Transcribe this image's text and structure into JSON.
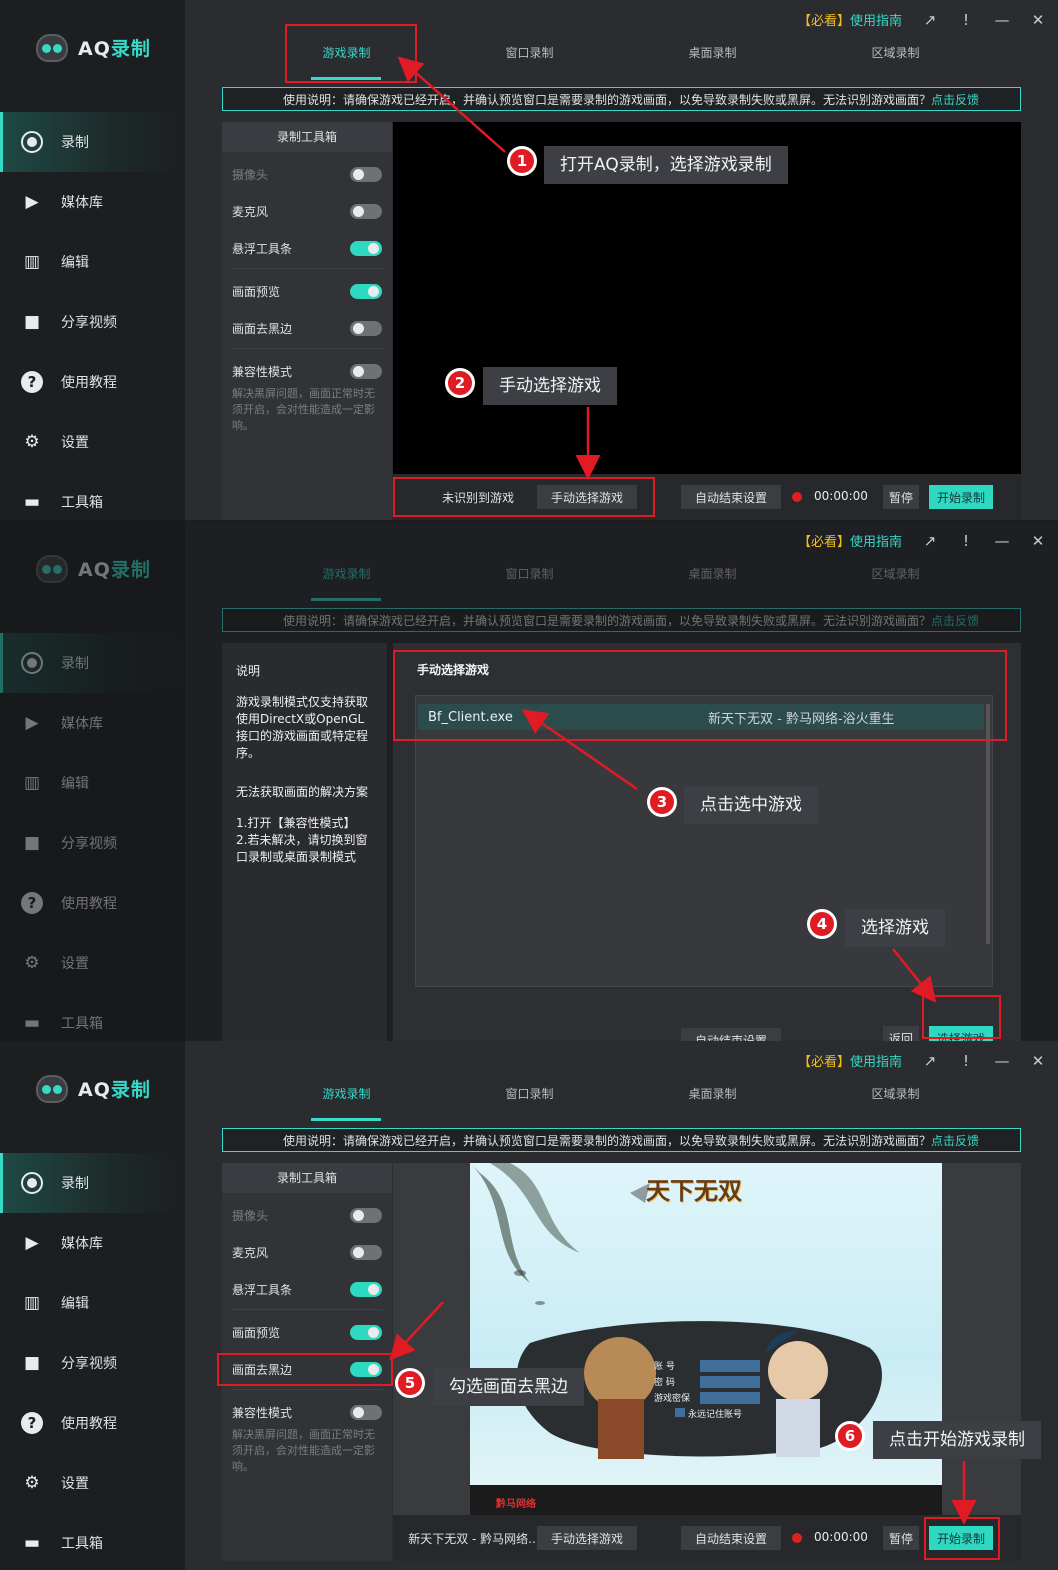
{
  "app": {
    "name_prefix": "AQ",
    "name_suffix": "录制"
  },
  "topbar": {
    "must_see": "【必看】",
    "guide": "使用指南"
  },
  "tabs": [
    "游戏录制",
    "窗口录制",
    "桌面录制",
    "区域录制"
  ],
  "nav": [
    "录制",
    "媒体库",
    "编辑",
    "分享视频",
    "使用教程",
    "设置",
    "工具箱"
  ],
  "notice": {
    "text": "使用说明：请确保游戏已经开启，并确认预览窗口是需要录制的游戏画面，以免导致录制失败或黑屏。无法识别游戏画面？",
    "feedback": "点击反馈"
  },
  "toolbox": {
    "title": "录制工具箱",
    "items": [
      {
        "label": "摄像头",
        "on": false,
        "dim": true
      },
      {
        "label": "麦克风",
        "on": false
      },
      {
        "label": "悬浮工具条",
        "on": true
      },
      {
        "label": "画面预览",
        "on": true
      },
      {
        "label": "画面去黑边",
        "on": false
      },
      {
        "label": "兼容性模式",
        "on": false
      }
    ],
    "note": "解决黑屏问题，画面正常时无须开启，会对性能造成一定影响。"
  },
  "bottom": {
    "status_unrecognized": "未识别到游戏",
    "manual_select": "手动选择游戏",
    "auto_end": "自动结束设置",
    "time": "00:00:00",
    "pause": "暂停",
    "start": "开始录制",
    "game_name": "新天下无双 - 黔马网络..",
    "back": "返回",
    "select_game": "选择游戏"
  },
  "desc_panel": {
    "title": "说明",
    "p1": "游戏录制模式仅支持获取使用DirectX或OpenGL接口的游戏画面或特定程序。",
    "p2": "无法获取画面的解决方案",
    "p3": "1.打开【兼容性模式】\n2.若未解决，请切换到窗口录制或桌面录制模式"
  },
  "dialog": {
    "title": "手动选择游戏",
    "exe": "Bf_Client.exe",
    "window": "新天下无双 - 黔马网络-浴火重生"
  },
  "callouts": {
    "c1": "打开AQ录制，选择游戏录制",
    "c2": "手动选择游戏",
    "c3": "点击选中游戏",
    "c4": "选择游戏",
    "c5": "勾选画面去黑边",
    "c6": "点击开始游戏录制"
  },
  "game": {
    "logo": "天下无双",
    "field1": "账  号",
    "field2": "密  码",
    "field3": "游戏密保",
    "remember": "永远记住账号",
    "publisher": "黔马网络"
  },
  "colors": {
    "accent": "#37d9c8",
    "annotation_red": "#e01b24",
    "toggle_on": "#2fd8c0"
  }
}
